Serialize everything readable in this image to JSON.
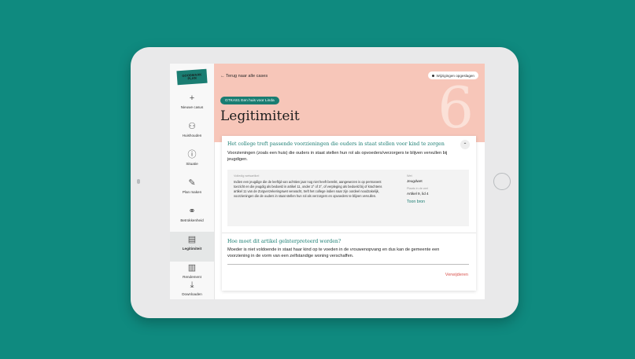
{
  "sidebar": {
    "logo_text": "GOODMAAK PLAN",
    "items": [
      {
        "label": "Nieuwe casus",
        "icon": "plus-icon"
      },
      {
        "label": "Huishouden",
        "icon": "household-icon"
      },
      {
        "label": "Situatie",
        "icon": "info-icon"
      },
      {
        "label": "Plan maken",
        "icon": "plan-icon"
      },
      {
        "label": "Betrokkenheid",
        "icon": "involvement-icon"
      },
      {
        "label": "Legitimiteit",
        "icon": "document-icon"
      },
      {
        "label": "Rendement",
        "icon": "chart-icon"
      },
      {
        "label": "Downloaden",
        "icon": "download-icon"
      }
    ]
  },
  "header": {
    "back_label": "Terug naar alle cases",
    "saved_label": "Wijzigingen opgeslagen",
    "case_tag": "GTKAS1 Een huis voor Linda",
    "title": "Legitimiteit",
    "step_number": "6"
  },
  "card": {
    "title": "Het college treft passende voorzieningen die ouders in staat stellen voor kind te zorgen",
    "body": "Voorzieningen (zoals een huis) die ouders in staat stellen hun rol als opvoeders/verzorgers te blijven vervullen bij jeugdigen.",
    "law": {
      "label": "Volledig wetsartikel",
      "text": "Indien een jeugdige die de leeftijd van achttien jaar nog niet heeft bereikt, aangewezen is op permanent toezicht en die jeugdig als bedoeld in artikel 11, onder 2° of 3°, of verpleging als bedoeld bij of krachtens artikel 11 van de Zorgverzekeringswet verwacht, treft het college indien naar zijn oordeel noodzakelijk, voorzieningen die de ouders in staat stellen hun rol als verzorgers en opvoeders te blijven vervullen.",
      "wet_label": "Wet",
      "wet_value": "Jeugdwet",
      "place_label": "Plaats in de wet",
      "place_value": "Artikel 9, lid 4",
      "source_label": "Toon bron"
    }
  },
  "question": {
    "title": "Hoe moet dit artikel geïnterpreteerd worden?",
    "answer": "Moeder is niet voldoende in staat haar kind op te voeden in de vrouwenopvang en dus kan de gemeente een voorziening in de vorm van een zelfstandige woning verschaffen.",
    "delete_label": "Verwijderen"
  },
  "colors": {
    "background": "#0f8a7f",
    "header": "#f7c6b9",
    "accent": "#1a7d72",
    "danger": "#d9544f"
  }
}
